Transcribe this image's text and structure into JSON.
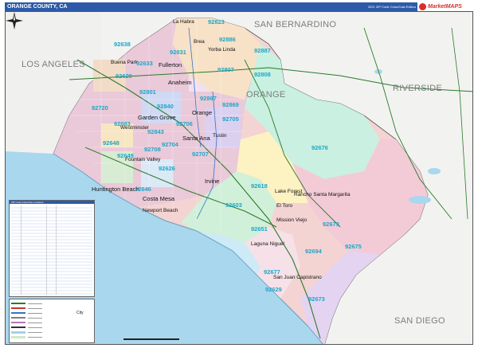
{
  "header": {
    "title": "ORANGE COUNTY, CA",
    "edition": "2021 ZIP Code Color/Cast Edition",
    "logo_text": "MarketMAPS"
  },
  "regions": [
    {
      "id": "san-bernardino",
      "label": "SAN BERNARDINO"
    },
    {
      "id": "los-angeles",
      "label": "LOS ANGELES"
    },
    {
      "id": "riverside",
      "label": "RIVERSIDE"
    },
    {
      "id": "orange",
      "label": "ORANGE"
    },
    {
      "id": "san-diego",
      "label": "SAN DIEGO"
    }
  ],
  "cities": [
    {
      "id": "la-habra",
      "label": "La Habra"
    },
    {
      "id": "brea",
      "label": "Brea"
    },
    {
      "id": "yorba-linda",
      "label": "Yorba Linda"
    },
    {
      "id": "fullerton",
      "label": "Fullerton"
    },
    {
      "id": "buena-park",
      "label": "Buena Park"
    },
    {
      "id": "anaheim",
      "label": "Anaheim"
    },
    {
      "id": "garden-grove",
      "label": "Garden Grove"
    },
    {
      "id": "orange",
      "label": "Orange"
    },
    {
      "id": "westminster",
      "label": "Westminster"
    },
    {
      "id": "santa-ana",
      "label": "Santa Ana"
    },
    {
      "id": "tustin",
      "label": "Tustin"
    },
    {
      "id": "fountain-valley",
      "label": "Fountain Valley"
    },
    {
      "id": "huntington-beach",
      "label": "Huntington Beach"
    },
    {
      "id": "costa-mesa",
      "label": "Costa Mesa"
    },
    {
      "id": "irvine",
      "label": "Irvine"
    },
    {
      "id": "newport-beach",
      "label": "Newport Beach"
    },
    {
      "id": "lake-forest",
      "label": "Lake Forest"
    },
    {
      "id": "el-toro",
      "label": "El Toro"
    },
    {
      "id": "mission-viejo",
      "label": "Mission Viejo"
    },
    {
      "id": "laguna-niguel",
      "label": "Laguna Niguel"
    },
    {
      "id": "san-juan-capistrano",
      "label": "San Juan Capistrano"
    },
    {
      "id": "rancho-santa-margarita",
      "label": "Rancho Santa Margarita"
    }
  ],
  "zip_codes": [
    {
      "id": "92823",
      "label": "92823"
    },
    {
      "id": "92638",
      "label": "92638"
    },
    {
      "id": "92831",
      "label": "92831"
    },
    {
      "id": "92886",
      "label": "92886"
    },
    {
      "id": "92887",
      "label": "92887"
    },
    {
      "id": "92633",
      "label": "92633"
    },
    {
      "id": "92620",
      "label": "92620"
    },
    {
      "id": "92801",
      "label": "92801"
    },
    {
      "id": "92807",
      "label": "92807"
    },
    {
      "id": "92808",
      "label": "92808"
    },
    {
      "id": "92720",
      "label": "92720"
    },
    {
      "id": "92840",
      "label": "92840"
    },
    {
      "id": "92867",
      "label": "92867"
    },
    {
      "id": "92869",
      "label": "92869"
    },
    {
      "id": "92705",
      "label": "92705"
    },
    {
      "id": "92683",
      "label": "92683"
    },
    {
      "id": "92706",
      "label": "92706"
    },
    {
      "id": "92843",
      "label": "92843"
    },
    {
      "id": "92704",
      "label": "92704"
    },
    {
      "id": "92707",
      "label": "92707"
    },
    {
      "id": "92648",
      "label": "92648"
    },
    {
      "id": "92708",
      "label": "92708"
    },
    {
      "id": "92649",
      "label": "92649"
    },
    {
      "id": "92626",
      "label": "92626"
    },
    {
      "id": "92646",
      "label": "92646"
    },
    {
      "id": "92676",
      "label": "92676"
    },
    {
      "id": "92618",
      "label": "92618"
    },
    {
      "id": "92603",
      "label": "92603"
    },
    {
      "id": "92651",
      "label": "92651"
    },
    {
      "id": "92679",
      "label": "92679"
    },
    {
      "id": "92675",
      "label": "92675"
    },
    {
      "id": "92694",
      "label": "92694"
    },
    {
      "id": "92677",
      "label": "92677"
    },
    {
      "id": "92629",
      "label": "92629"
    },
    {
      "id": "92673",
      "label": "92673"
    }
  ],
  "legend": {
    "table_header": "ZIP Code Index/City Locations",
    "key_items": [
      {
        "id": "interstate",
        "color": "#2a7a2a"
      },
      {
        "id": "us-highway",
        "color": "#c0392b"
      },
      {
        "id": "state-highway",
        "color": "#3a6fc4"
      },
      {
        "id": "primary-road",
        "color": "#7f7f7f"
      },
      {
        "id": "zip-boundary",
        "color": "#b07ab0"
      },
      {
        "id": "county-boundary",
        "color": "#333333"
      },
      {
        "id": "water",
        "color": "#9fd3ea"
      },
      {
        "id": "parks",
        "color": "#cfe9c8"
      }
    ],
    "city_key_label": "City"
  },
  "colors": {
    "ocean": "#a9d7ee",
    "county_fill": "#f4d3d3",
    "outside": "#f2f2f0",
    "zip_text": "#1ca7c9",
    "header_bg": "#2d5aa8"
  }
}
